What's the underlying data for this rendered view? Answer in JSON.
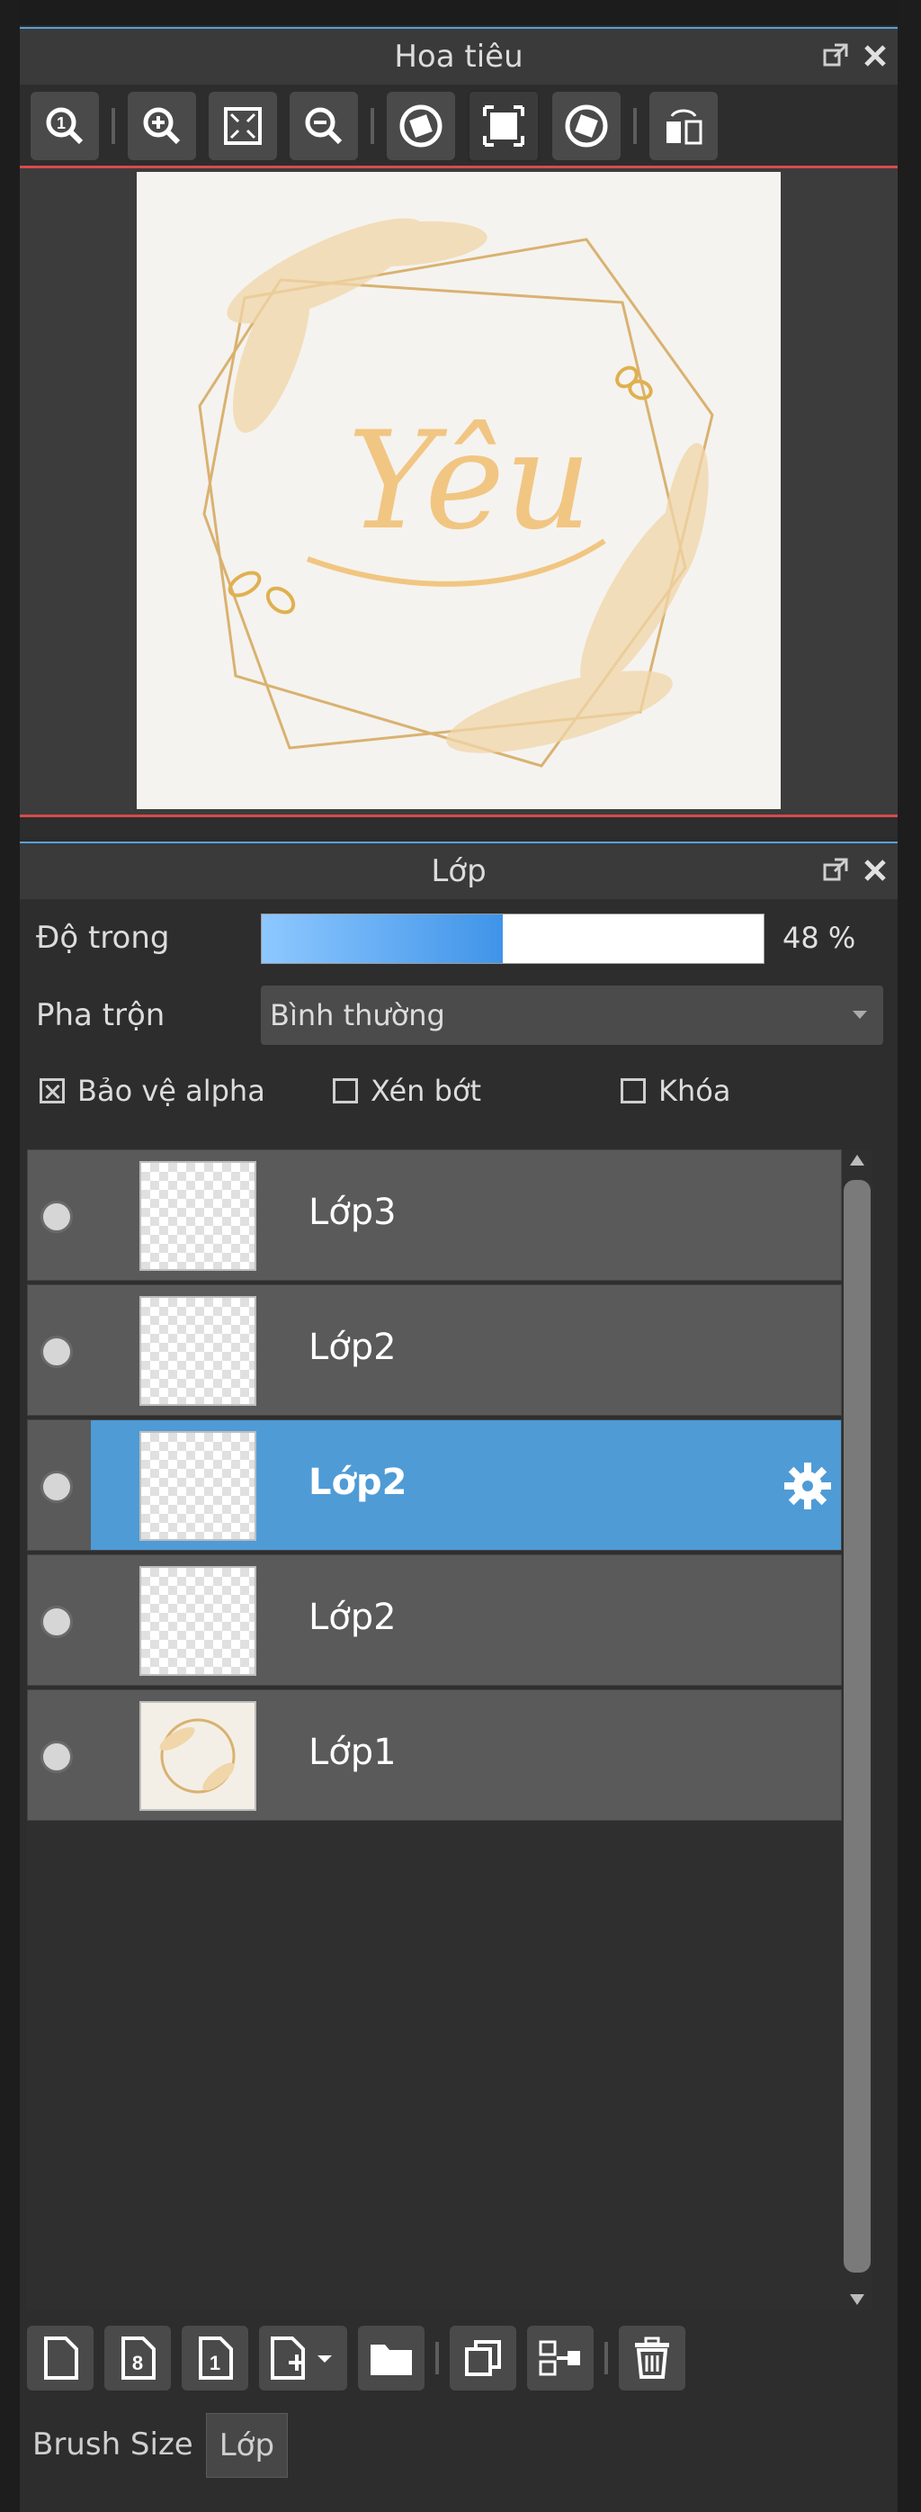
{
  "navigator": {
    "title": "Hoa tiêu",
    "canvas_text": "Yêu",
    "toolbar_icons": [
      "zoom-100-icon",
      "zoom-in-icon",
      "fit-window-icon",
      "zoom-out-icon",
      "rotate-left-icon",
      "actual-pixels-icon",
      "rotate-right-icon",
      "flip-horizontal-icon"
    ]
  },
  "layer_panel": {
    "title": "Lớp",
    "opacity_label": "Độ trong",
    "opacity_value": "48 %",
    "opacity": 0.48,
    "blend_label": "Pha trộn",
    "blend_value": "Bình thường",
    "checkboxes": [
      {
        "label": "Bảo vệ alpha",
        "checked": true
      },
      {
        "label": "Xén bớt",
        "checked": false
      },
      {
        "label": "Khóa",
        "checked": false
      }
    ],
    "layers": [
      {
        "name": "Lớp3",
        "selected": false
      },
      {
        "name": "Lớp2",
        "selected": false
      },
      {
        "name": "Lớp2",
        "selected": true
      },
      {
        "name": "Lớp2",
        "selected": false
      },
      {
        "name": "Lớp1",
        "selected": false
      }
    ],
    "bottom_tools": [
      "new-layer-icon",
      "new-8bit-layer-icon",
      "new-1bit-layer-icon",
      "add-layer-dropdown-icon",
      "folder-icon",
      "duplicate-layer-icon",
      "merge-down-icon",
      "delete-layer-icon"
    ]
  },
  "tabs": [
    "Brush Size",
    "Lớp"
  ],
  "colors": {
    "accent": "#4f9bd6",
    "selection_line": "#d84b4b",
    "panel": "#2d2d2d"
  }
}
